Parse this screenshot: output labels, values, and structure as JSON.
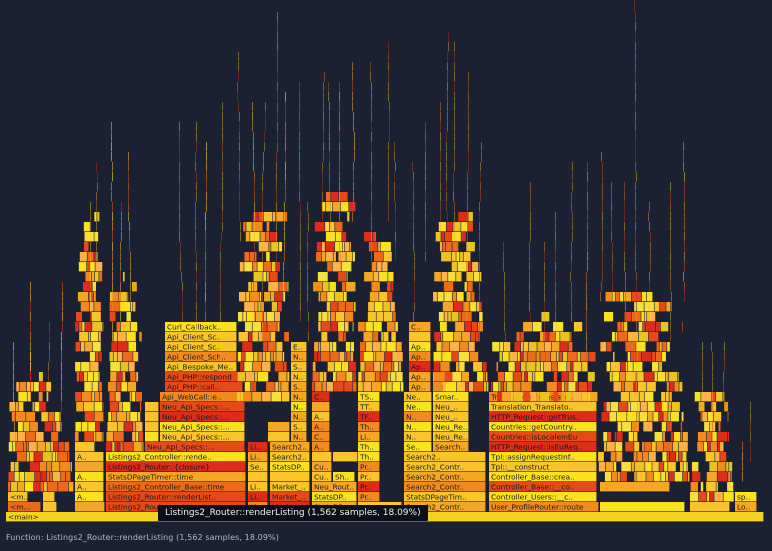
{
  "chart_data": {
    "type": "flame graph",
    "samples_unit": "samples",
    "root": {
      "name": "<main>",
      "children": [
        {
          "name": "<m...",
          "children": []
        },
        {
          "name": "S...",
          "children": []
        },
        {
          "name": "Listings2_Router::route",
          "children": [
            {
              "name": "Listings2_Router::renderList..",
              "samples": 1562,
              "percent": 18.09,
              "children": [
                {
                  "name": "Listings2_Controller_Base::rende..",
                  "children": []
                },
                {
                  "name": "Listings2_Controller_Base::time",
                  "children": []
                },
                {
                  "name": "StatsDPageTimer::time",
                  "children": []
                },
                {
                  "name": "Listings2_Router::{closure}",
                  "children": []
                },
                {
                  "name": "Listings2_Controller::rende..",
                  "children": []
                }
              ]
            }
          ]
        },
        {
          "name": "Neu_Api_Specs::...",
          "children": [
            {
              "name": "Api_WebCall::e..",
              "children": []
            },
            {
              "name": "Api_PHP::call..",
              "children": []
            },
            {
              "name": "Api_PHP::respond",
              "children": []
            },
            {
              "name": "Api_Bespoke_Me..",
              "children": []
            },
            {
              "name": "Api_Client_Sch..",
              "children": []
            },
            {
              "name": "Api_Client_Sc..",
              "children": []
            },
            {
              "name": "Curl_Callback..",
              "children": []
            }
          ]
        },
        {
          "name": "Market_..",
          "children": []
        },
        {
          "name": "StatsDP..",
          "children": []
        },
        {
          "name": "Search2_Contr..",
          "children": [
            {
              "name": "TSock..",
              "children": []
            },
            {
              "name": "TTran..",
              "children": []
            },
            {
              "name": "TFram..",
              "children": []
            },
            {
              "name": "Thrif..",
              "children": []
            },
            {
              "name": "ProLi..",
              "children": []
            }
          ]
        },
        {
          "name": "StatsDPageTim..",
          "children": []
        },
        {
          "name": "User_ProfileRouter::route",
          "children": [
            {
              "name": "Controller_Users::__c..",
              "children": []
            },
            {
              "name": "Controller_Base::__co..",
              "children": []
            },
            {
              "name": "Controller_Base::crea..",
              "children": []
            },
            {
              "name": "Tpl::__construct",
              "children": []
            },
            {
              "name": "Tpl::assignRequestInf..",
              "children": []
            },
            {
              "name": "HTTP_Request::isEuReq..",
              "children": []
            },
            {
              "name": "Countries::isLocaleInEu",
              "children": []
            },
            {
              "name": "Countries::getCountry..",
              "children": []
            },
            {
              "name": "HTTP_Request::getTrus..",
              "children": []
            },
            {
              "name": "Translation_Translato..",
              "children": []
            }
          ]
        },
        {
          "name": "Load..",
          "children": []
        },
        {
          "name": "spl_au..",
          "children": []
        }
      ]
    }
  },
  "tooltip": {
    "text": "Listings2_Router::renderListing (1,562 samples, 18.09%)"
  },
  "status_bar": {
    "text": "Function: Listings2_Router::renderListing (1,562 samples, 18.09%)"
  },
  "labels": {
    "main": "<main>",
    "m": "<m...",
    "s": "S...",
    "router_route": "Listings2_Router::route",
    "render_list": "Listings2_Router::renderList..",
    "ctrl_base_time": "Listings2_Controller_Base::time",
    "ctrl_base_rende": "Listings2_Controller_Base::rende..",
    "pagetimer": "StatsDPageTimer::time",
    "router_closure": "Listings2_Router::{closure}",
    "ctrl_rende": "Listings2_Controller::rende..",
    "neu_specs": "Neu_Api_Specs::...",
    "neu_specs2": "Neu_Api_Specs::...",
    "neu_specs3": "Neu_Api_Specs::...",
    "neu_specs4": "Neu_Api_Specs::...",
    "neu_specs5": "Neu_Api_Specs::...",
    "neu_specs6": "Neu_Api_Specs::...",
    "api_webcall": "Api_WebCall::e..",
    "api_php_call": "Api_PHP::call..",
    "api_php_respond": "Api_PHP::respond",
    "api_bespoke": "Api_Bespoke_Me..",
    "api_client_sch": "Api_Client_Sch..",
    "api_client_sc": "Api_Client_Sc..",
    "api_client_sc2": "Api_Client_Sc..",
    "curl": "Curl_Callback..",
    "market": "Market_..",
    "market_root": "Market_..",
    "neu_rout": "Neu_Rout..",
    "statsdp": "StatsDP..",
    "li": "Li..",
    "search2": "Search2..",
    "search2_contr": "Search2_Contr..",
    "search2_contr2": "Search2_Contr..",
    "search2_contr3": "Search2_Contr..",
    "statsdpagetim": "StatsDPageTim..",
    "tsock": "TSock..",
    "ttran": "TTran..",
    "tfram": "TFram..",
    "thrif": "Thrif..",
    "proli": "ProLi..",
    "listi": "Listi..",
    "neu_ren": "Neu_Ren..",
    "neu_": "Neu_..",
    "smar": "Smar..",
    "ep": "EP_..",
    "sma": "sma..",
    "ap": "Ap..",
    "user_profile": "User_ProfileRouter::route",
    "ctrl_users": "Controller_Users::__c..",
    "ctrl_base_co": "Controller_Base::__co..",
    "ctrl_base_crea": "Controller_Base::crea..",
    "tpl_construct": "Tpl::__construct",
    "tpl_assign": "Tpl::assignRequestInf..",
    "http_iseu": "HTTP_Request::isEuReq..",
    "countries_iseu": "Countries::isLocaleInEu",
    "countries_get": "Countries::getCountry..",
    "http_gettrus": "HTTP_Request::getTrus..",
    "translation": "Translation_Translato..",
    "translation2": "Translation_Translato..",
    "load": "Load..",
    "spl": "spl_au..",
    "sho": "Sho..",
    "cu": "Cu..",
    "a": "A..",
    "t": "T..",
    "c": "C..",
    "n": "N..",
    "e": "E..",
    "se": "Se..",
    "st": "St..",
    "ne": "Ne..",
    "ap2": "Ap.."
  },
  "colors": {
    "background": "#1b2133",
    "palette": [
      "#fce11f",
      "#f9c52a",
      "#f5a623",
      "#f28a1e",
      "#ee6a1b",
      "#e64a18",
      "#dd2c1a",
      "#f7e03a",
      "#e9c320",
      "#ffb347"
    ]
  }
}
